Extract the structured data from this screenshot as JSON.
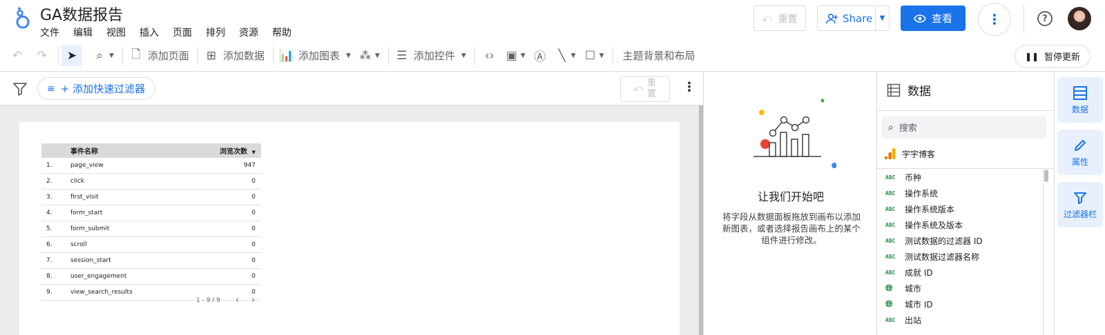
{
  "app": {
    "title": "GA数据报告",
    "menu": [
      "文件",
      "编辑",
      "视图",
      "插入",
      "页面",
      "排列",
      "资源",
      "帮助"
    ],
    "reset_label": "重置",
    "share_label": "Share",
    "view_label": "查看"
  },
  "toolbar": {
    "add_page": "添加页面",
    "add_data": "添加数据",
    "add_chart": "添加图表",
    "add_control": "添加控件",
    "theme_layout": "主题背景和布局",
    "pause_update": "暂停更新"
  },
  "filterbar": {
    "add_quick_filter": "+ 添加快速过滤器",
    "reset_label": "重置"
  },
  "table": {
    "headers": {
      "name": "事件名称",
      "value": "浏览次数"
    },
    "rows": [
      {
        "n": "1.",
        "name": "page_view",
        "value": "947"
      },
      {
        "n": "2.",
        "name": "click",
        "value": "0"
      },
      {
        "n": "3.",
        "name": "first_visit",
        "value": "0"
      },
      {
        "n": "4.",
        "name": "form_start",
        "value": "0"
      },
      {
        "n": "5.",
        "name": "form_submit",
        "value": "0"
      },
      {
        "n": "6.",
        "name": "scroll",
        "value": "0"
      },
      {
        "n": "7.",
        "name": "session_start",
        "value": "0"
      },
      {
        "n": "8.",
        "name": "user_engagement",
        "value": "0"
      },
      {
        "n": "9.",
        "name": "view_search_results",
        "value": "0"
      }
    ],
    "pager": "1 - 9 / 9"
  },
  "empty_state": {
    "heading": "让我们开始吧",
    "body": "将字段从数据面板拖放到画布以添加新图表，或者选择报告画布上的某个组件进行修改。"
  },
  "data_panel": {
    "title": "数据",
    "search_placeholder": "搜索",
    "source": "宇宇博客",
    "fields": [
      {
        "type": "ABC",
        "label": "币种"
      },
      {
        "type": "ABC",
        "label": "操作系统"
      },
      {
        "type": "ABC",
        "label": "操作系统版本"
      },
      {
        "type": "ABC",
        "label": "操作系统及版本"
      },
      {
        "type": "ABC",
        "label": "测试数据的过滤器 ID"
      },
      {
        "type": "ABC",
        "label": "测试数据过滤器名称"
      },
      {
        "type": "ABC",
        "label": "成就 ID"
      },
      {
        "type": "geo",
        "label": "城市"
      },
      {
        "type": "geo",
        "label": "城市 ID"
      },
      {
        "type": "ABC",
        "label": "出站"
      }
    ]
  },
  "rail": {
    "data": "数据",
    "properties": "属性",
    "filter_bar": "过滤器栏"
  },
  "colors": {
    "accent": "#1a73e8",
    "field_type": "#1e8e3e"
  }
}
